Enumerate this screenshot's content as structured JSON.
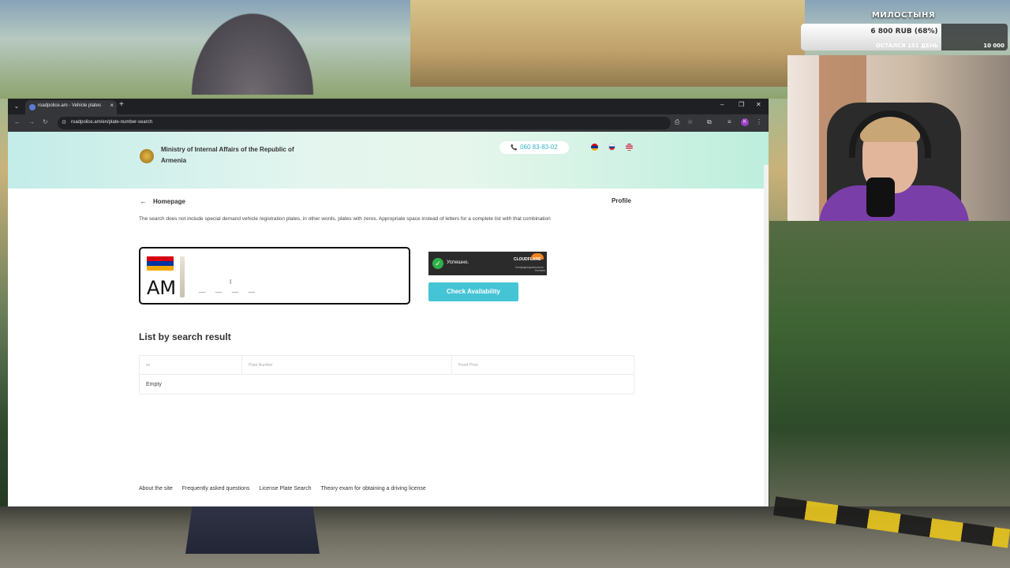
{
  "stream": {
    "donation_title": "МИЛОСТЫНЯ",
    "donation_amount": "6 800 RUB (68%)",
    "donation_progress": 0.68,
    "donation_left": "ОСТАЛСЯ 151 ДЕНЬ",
    "donation_goal": "10 000"
  },
  "browser": {
    "tab_title": "roadpolice.am - Vehicle plates",
    "url": "roadpolice.am/en/plate-number-search",
    "avatar_letter": "K"
  },
  "header": {
    "ministry": "Ministry of Internal Affairs of the Republic of Armenia",
    "phone": "060 83-83-02",
    "languages": [
      "hy",
      "ru",
      "en"
    ],
    "colors": {
      "phone": "#38b2c8",
      "accent": "#45c4d6"
    }
  },
  "nav": {
    "back_label": "Homepage",
    "profile_label": "Profile"
  },
  "notice": "The search does not include special demand vehicle registration plates, in other words, plates with zeros. Appropriate space instead of letters for a complete list with that combination",
  "plate": {
    "country_code": "AM",
    "input_placeholder": "_ _ _ _",
    "flag_colors": [
      "#d90012",
      "#0033a0",
      "#f2a800"
    ]
  },
  "captcha": {
    "status": "Успешно.",
    "brand": "CLOUDFLARE",
    "sub": "Конфиденциальность · Условия"
  },
  "check_button": "Check Availability",
  "results": {
    "title": "List by search result",
    "columns": [
      "№",
      "Plate Number",
      "Fixed Price"
    ],
    "empty_label": "Empty"
  },
  "footer": {
    "links": [
      "About the site",
      "Frequently asked questions",
      "License Plate Search",
      "Theory exam for obtaining a driving license"
    ]
  }
}
